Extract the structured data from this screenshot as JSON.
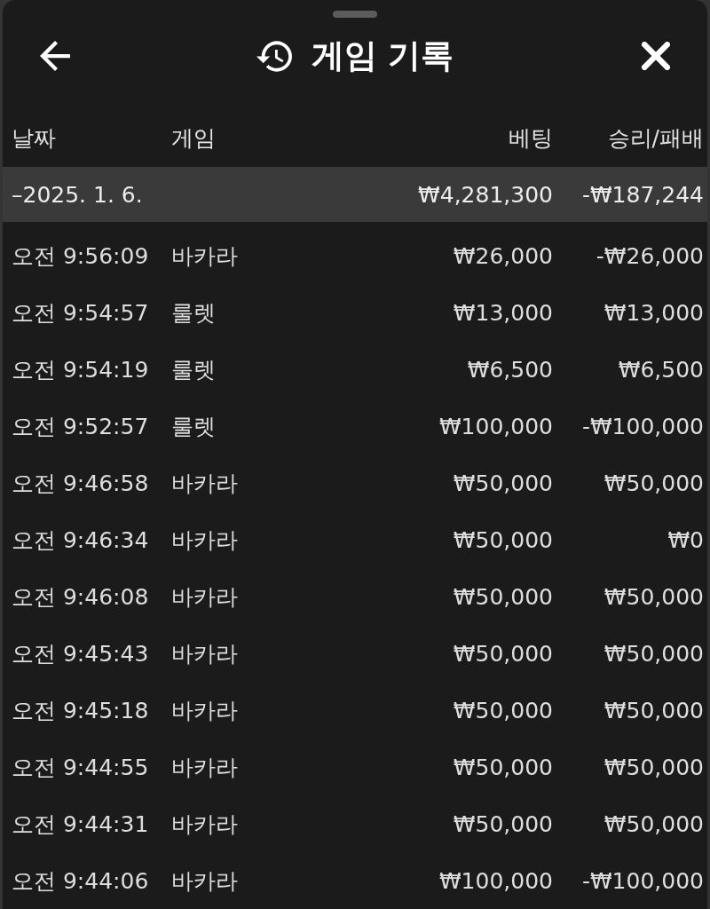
{
  "sheet": {
    "title": "게임 기록"
  },
  "table": {
    "columns": [
      "날짜",
      "게임",
      "베팅",
      "승리/패배"
    ],
    "group": {
      "date": "–2025. 1. 6.",
      "bet": "₩4,281,300",
      "result": "-₩187,244"
    },
    "rows": [
      {
        "time": "오전 9:56:09",
        "game": "바카라",
        "bet": "₩26,000",
        "result": "-₩26,000"
      },
      {
        "time": "오전 9:54:57",
        "game": "룰렛",
        "bet": "₩13,000",
        "result": "₩13,000"
      },
      {
        "time": "오전 9:54:19",
        "game": "룰렛",
        "bet": "₩6,500",
        "result": "₩6,500"
      },
      {
        "time": "오전 9:52:57",
        "game": "룰렛",
        "bet": "₩100,000",
        "result": "-₩100,000"
      },
      {
        "time": "오전 9:46:58",
        "game": "바카라",
        "bet": "₩50,000",
        "result": "₩50,000"
      },
      {
        "time": "오전 9:46:34",
        "game": "바카라",
        "bet": "₩50,000",
        "result": "₩0"
      },
      {
        "time": "오전 9:46:08",
        "game": "바카라",
        "bet": "₩50,000",
        "result": "₩50,000"
      },
      {
        "time": "오전 9:45:43",
        "game": "바카라",
        "bet": "₩50,000",
        "result": "₩50,000"
      },
      {
        "time": "오전 9:45:18",
        "game": "바카라",
        "bet": "₩50,000",
        "result": "₩50,000"
      },
      {
        "time": "오전 9:44:55",
        "game": "바카라",
        "bet": "₩50,000",
        "result": "₩50,000"
      },
      {
        "time": "오전 9:44:31",
        "game": "바카라",
        "bet": "₩50,000",
        "result": "₩50,000"
      },
      {
        "time": "오전 9:44:06",
        "game": "바카라",
        "bet": "₩100,000",
        "result": "-₩100,000"
      }
    ]
  }
}
